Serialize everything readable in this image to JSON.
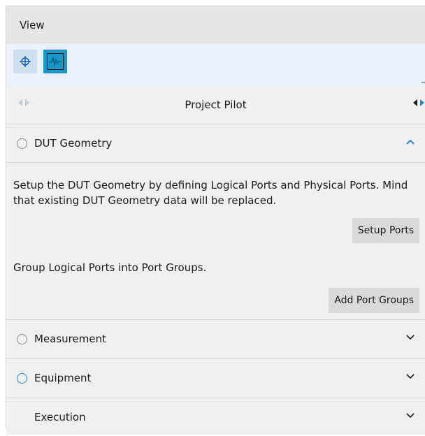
{
  "menubar": {
    "view_label": "View"
  },
  "toolbar": {
    "crosshair_icon": "crosshair-icon",
    "waveform_icon": "waveform-icon",
    "accent": "#1798c8"
  },
  "pilot": {
    "title": "Project Pilot"
  },
  "sections": [
    {
      "label": "DUT Geometry",
      "expanded": true,
      "description": "Setup the DUT Geometry by defining Logical Ports and Physical Ports. Mind that existing DUT Geometry data will be replaced.",
      "setup_button": "Setup Ports",
      "group_text": "Group Logical Ports into Port Groups.",
      "group_button": "Add Port Groups"
    },
    {
      "label": "Measurement",
      "expanded": false
    },
    {
      "label": "Equipment",
      "expanded": false
    },
    {
      "label": "Execution",
      "expanded": false
    }
  ]
}
